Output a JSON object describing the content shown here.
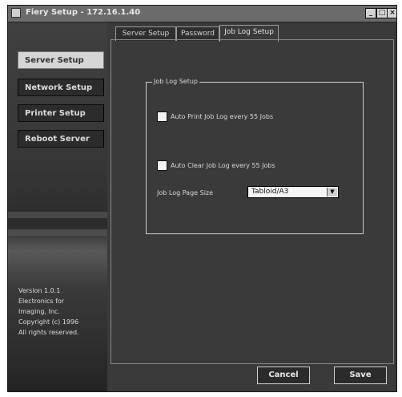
{
  "window": {
    "title": "Fiery Setup - 172.16.1.40"
  },
  "sidebar": {
    "items": [
      {
        "label": "Server Setup",
        "active": true
      },
      {
        "label": "Network Setup",
        "active": false
      },
      {
        "label": "Printer Setup",
        "active": false
      },
      {
        "label": "Reboot Server",
        "active": false
      }
    ],
    "version_lines": [
      "Version 1.0.1",
      "Electronics for",
      "Imaging, Inc.",
      "Copyright (c) 1996",
      "All rights reserved."
    ]
  },
  "tabs": [
    {
      "label": "Server Setup",
      "active": false
    },
    {
      "label": "Password",
      "active": false
    },
    {
      "label": "Job Log Setup",
      "active": true
    }
  ],
  "job_log": {
    "group_title": "Job Log Setup",
    "auto_print_label": "Auto Print Job Log every 55 Jobs",
    "auto_print_checked": false,
    "auto_clear_label": "Auto Clear Job Log every 55 Jobs",
    "auto_clear_checked": false,
    "page_size_label": "Job Log Page Size",
    "page_size_value": "Tabloid/A3"
  },
  "footer": {
    "cancel_label": "Cancel",
    "save_label": "Save"
  }
}
